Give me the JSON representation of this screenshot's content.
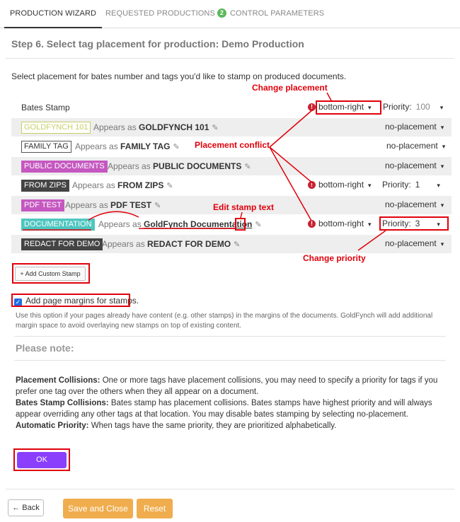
{
  "tabs": [
    {
      "label": "PRODUCTION WIZARD",
      "active": true
    },
    {
      "label": "REQUESTED PRODUCTIONS",
      "count": "2"
    },
    {
      "label": "CONTROL PARAMETERS"
    }
  ],
  "step_title": "Step 6. Select tag placement for production: Demo Production",
  "intro": "Select placement for bates number and tags you'd like to stamp on produced documents.",
  "appears_as": "Appears as",
  "bates": {
    "label": "Bates Stamp",
    "placement": "bottom-right",
    "priority_label": "Priority:",
    "priority": "100"
  },
  "tags": [
    {
      "name": "GOLDFYNCH 101",
      "appears": "GOLDFYNCH 101",
      "placement": "no-placement",
      "bg": "#ffffff",
      "fg": "#c7cf62",
      "border": "#c7cf62",
      "shaded": true
    },
    {
      "name": "FAMILY TAG",
      "appears": "FAMILY TAG",
      "placement": "no-placement",
      "bg": "#ffffff",
      "fg": "#333333",
      "border": "#555555",
      "shaded": false
    },
    {
      "name": "PUBLIC DOCUMENTS",
      "appears": "PUBLIC DOCUMENTS",
      "placement": "no-placement",
      "bg": "#c558c0",
      "fg": "#ffffff",
      "border": "#c558c0",
      "shaded": true
    },
    {
      "name": "FROM ZIPS",
      "appears": "FROM ZIPS",
      "placement": "bottom-right",
      "priority_label": "Priority:",
      "priority": "1",
      "conflict": true,
      "bg": "#444444",
      "fg": "#ffffff",
      "border": "#444444",
      "shaded": false
    },
    {
      "name": "PDF TEST",
      "appears": "PDF TEST",
      "placement": "no-placement",
      "bg": "#c558c0",
      "fg": "#ffffff",
      "border": "#c558c0",
      "shaded": true
    },
    {
      "name": "DOCUMENTATION",
      "appears": "GoldFynch Documentation",
      "placement": "bottom-right",
      "priority_label": "Priority:",
      "priority": "3",
      "conflict": true,
      "bg": "#4ec6c0",
      "fg": "#ffffff",
      "border": "#4ec6c0",
      "shaded": false
    },
    {
      "name": "REDACT FOR DEMO",
      "appears": "REDACT FOR DEMO",
      "placement": "no-placement",
      "bg": "#444444",
      "fg": "#ffffff",
      "border": "#444444",
      "shaded": true
    }
  ],
  "add_custom_stamp": "Add Custom Stamp",
  "margins_label": "Add page margins for stamps.",
  "margins_help": "Use this option if your pages already have content (e.g. other stamps) in the margins of the documents. GoldFynch will add additional margin space to avoid overlaying new stamps on top of existing content.",
  "please_note": "Please note:",
  "notes": [
    {
      "title": "Placement Collisions:",
      "text": " One or more tags have placement collisions, you may need to specify a priority for tags if you prefer one tag over the others when they all appear on a document."
    },
    {
      "title": "Bates Stamp Collisions:",
      "text": " Bates stamp has placement collisions. Bates stamps have highest priority and will always appear overriding any other tags at that location. You may disable bates stamping by selecting no-placement."
    },
    {
      "title": "Automatic Priority:",
      "text": " When tags have the same priority, they are prioritized alphabetically."
    }
  ],
  "ok_label": "OK",
  "back_label": "Back",
  "save_close_label": "Save and Close",
  "reset_label": "Reset",
  "annotations": {
    "change_placement": "Change placement",
    "placement_conflict": "Placement conflict",
    "edit_stamp_text": "Edit stamp text",
    "change_priority": "Change priority"
  },
  "colors": {
    "accent_purple": "#8a3ffc",
    "orange": "#f0ad4e",
    "annotation_red": "#e0000b",
    "warning": "#c82333",
    "badge_green": "#5cb85c"
  }
}
